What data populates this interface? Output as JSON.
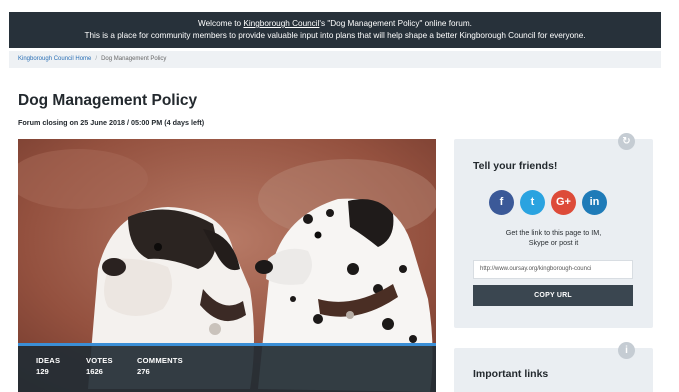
{
  "banner": {
    "line1_prefix": "Welcome to ",
    "line1_link": "Kingborough Council",
    "line1_suffix": "'s \"Dog Management Policy\" online forum.",
    "line2": "This is a place for community members to provide valuable input into plans that will help shape a better Kingborough Council for everyone."
  },
  "breadcrumb": {
    "home": "Kingborough Council Home",
    "separator": "/",
    "current": "Dog Management Policy"
  },
  "page": {
    "title": "Dog Management Policy",
    "closing": "Forum closing on 25 June 2018 / 05:00 PM (4 days left)"
  },
  "stats": [
    {
      "label": "IDEAS",
      "value": "129"
    },
    {
      "label": "VOTES",
      "value": "1626"
    },
    {
      "label": "COMMENTS",
      "value": "276"
    }
  ],
  "share": {
    "heading": "Tell your friends!",
    "icon": "refresh-icon",
    "social": [
      {
        "glyph": "f",
        "name": "facebook-icon",
        "color": "#3b5998"
      },
      {
        "glyph": "t",
        "name": "twitter-icon",
        "color": "#2aa3e0"
      },
      {
        "glyph": "G+",
        "name": "google-plus-icon",
        "color": "#dd4b39"
      },
      {
        "glyph": "in",
        "name": "linkedin-icon",
        "color": "#1f7bb8"
      }
    ],
    "text_line1": "Get the link to this page to IM,",
    "text_line2": "Skype or post it",
    "url": "http://www.oursay.org/kingborough-counci",
    "copy_label": "COPY URL"
  },
  "links": {
    "heading": "Important links",
    "icon": "info-icon",
    "icon_glyph": "i"
  },
  "colors": {
    "banner_bg": "#27313a",
    "accent": "#3b8fd6",
    "button": "#3a4650"
  }
}
